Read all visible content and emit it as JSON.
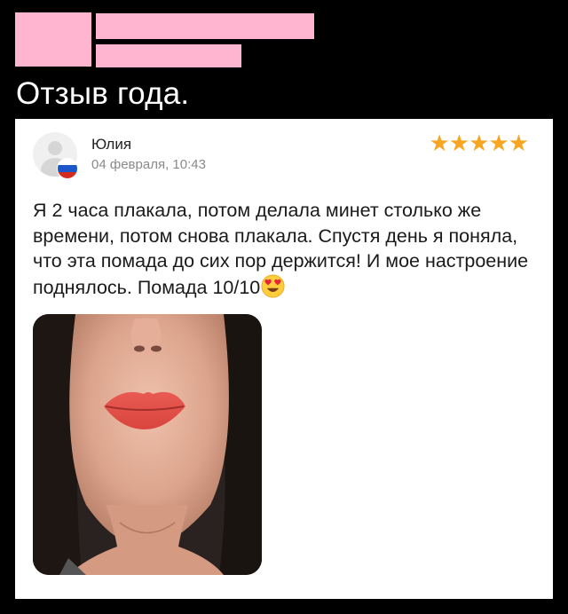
{
  "caption": "Отзыв года.",
  "review": {
    "author": "Юлия",
    "date": "04 февраля, 10:43",
    "stars": "★★★★★",
    "text": "Я 2 часа плакала, потом делала минет столько же времени, потом снова плакала. Спустя день я поняла, что эта помада до сих пор держится! И мое настроение поднялось. Помада 10/10",
    "emoji": "heart-eyes-emoji"
  },
  "colors": {
    "background": "#000000",
    "redaction": "#ffb4cf",
    "stars": "#f6a623",
    "lips": "#e4514a"
  }
}
